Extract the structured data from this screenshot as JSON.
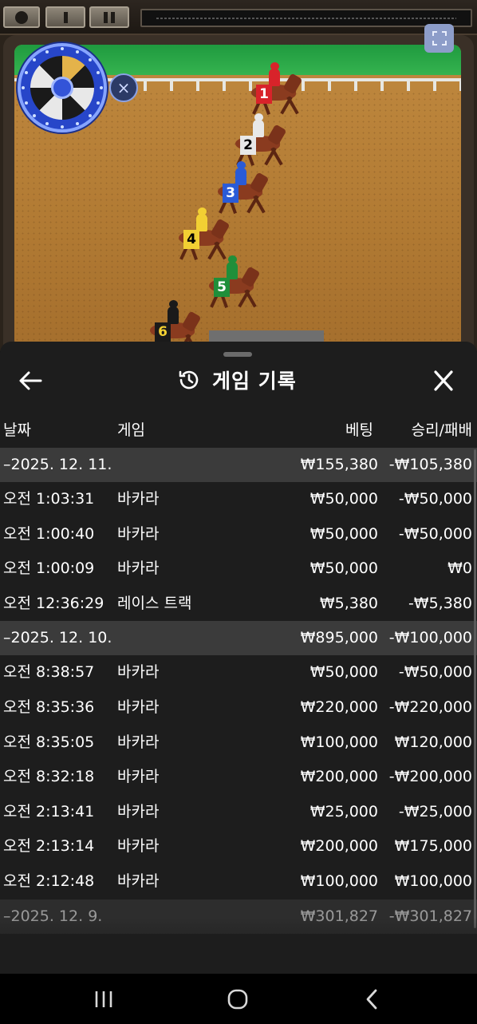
{
  "game": {
    "horses": [
      {
        "number": "1",
        "color": "#d8232a",
        "text_color": "#ffffff"
      },
      {
        "number": "2",
        "color": "#e8e8e8",
        "text_color": "#000000"
      },
      {
        "number": "3",
        "color": "#2a5bd7",
        "text_color": "#ffffff"
      },
      {
        "number": "4",
        "color": "#f2d033",
        "text_color": "#000000"
      },
      {
        "number": "5",
        "color": "#1f8f3a",
        "text_color": "#ffffff"
      },
      {
        "number": "6",
        "color": "#1a1a1a",
        "text_color": "#f2d033"
      }
    ]
  },
  "history": {
    "title": "게임 기록",
    "columns": {
      "date": "날짜",
      "game": "게임",
      "bet": "베팅",
      "win_loss": "승리/패배"
    },
    "days": [
      {
        "date": "–2025. 12. 11.",
        "bet_total": "₩155,380",
        "wl_total": "-₩105,380",
        "rows": [
          {
            "time": "오전 1:03:31",
            "game": "바카라",
            "bet": "₩50,000",
            "wl": "-₩50,000"
          },
          {
            "time": "오전 1:00:40",
            "game": "바카라",
            "bet": "₩50,000",
            "wl": "-₩50,000"
          },
          {
            "time": "오전 1:00:09",
            "game": "바카라",
            "bet": "₩50,000",
            "wl": "₩0"
          },
          {
            "time": "오전 12:36:29",
            "game": "레이스 트랙",
            "bet": "₩5,380",
            "wl": "-₩5,380"
          }
        ]
      },
      {
        "date": "–2025. 12. 10.",
        "bet_total": "₩895,000",
        "wl_total": "-₩100,000",
        "rows": [
          {
            "time": "오전 8:38:57",
            "game": "바카라",
            "bet": "₩50,000",
            "wl": "-₩50,000"
          },
          {
            "time": "오전 8:35:36",
            "game": "바카라",
            "bet": "₩220,000",
            "wl": "-₩220,000"
          },
          {
            "time": "오전 8:35:05",
            "game": "바카라",
            "bet": "₩100,000",
            "wl": "₩120,000"
          },
          {
            "time": "오전 8:32:18",
            "game": "바카라",
            "bet": "₩200,000",
            "wl": "-₩200,000"
          },
          {
            "time": "오전 2:13:41",
            "game": "바카라",
            "bet": "₩25,000",
            "wl": "-₩25,000"
          },
          {
            "time": "오전 2:13:14",
            "game": "바카라",
            "bet": "₩200,000",
            "wl": "₩175,000"
          },
          {
            "time": "오전 2:12:48",
            "game": "바카라",
            "bet": "₩100,000",
            "wl": "₩100,000"
          }
        ]
      },
      {
        "date": "–2025. 12. 9.",
        "bet_total": "₩301,827",
        "wl_total": "-₩301,827",
        "rows": []
      }
    ]
  },
  "icons": {
    "back": "arrow-left-icon",
    "close": "close-icon",
    "history": "history-icon",
    "fullscreen": "fullscreen-icon"
  }
}
